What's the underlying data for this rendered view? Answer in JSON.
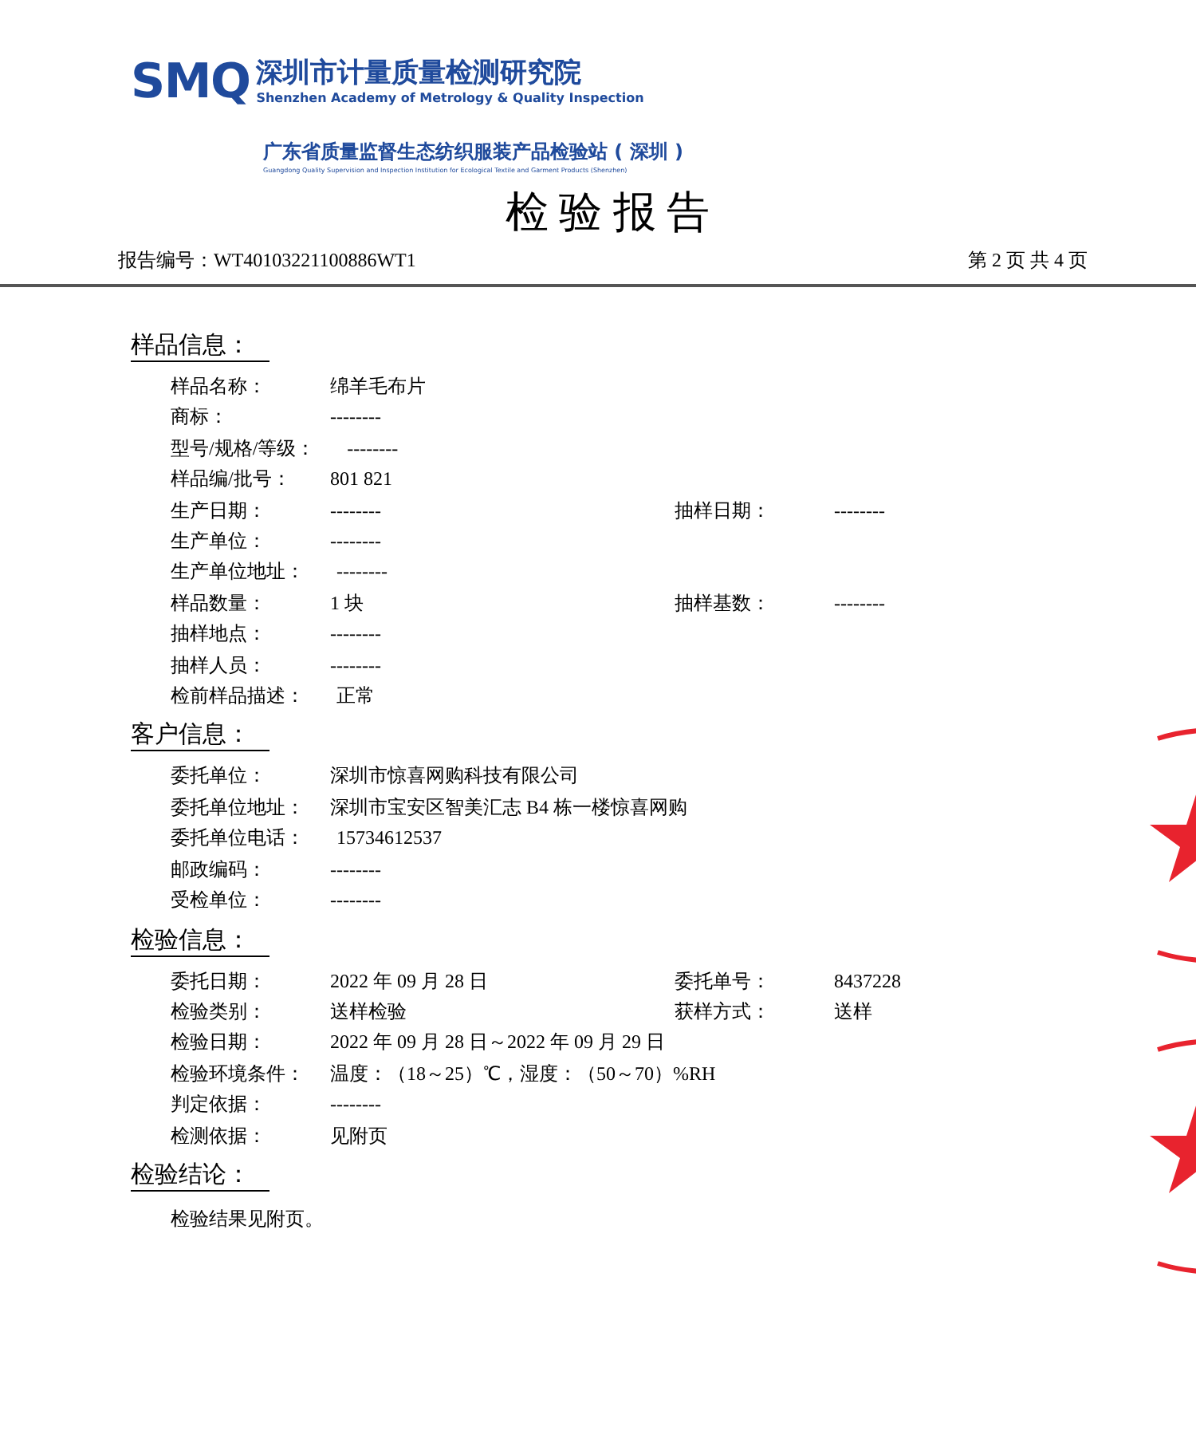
{
  "header": {
    "logo_mark": "SMQ",
    "org_name": "深圳市计量质量检测研究院",
    "org_name_en": "Shenzhen Academy of Metrology & Quality Inspection",
    "station_name": "广东省质量监督生态纺织服装产品检验站 ( 深圳 )",
    "station_name_en": "Guangdong Quality Supervision and Inspection Institution for Ecological Textile and Garment Products (Shenzhen)"
  },
  "title": "检 验 报 告",
  "report_no_label": "报告编号：",
  "report_no": "WT40103221100886WT1",
  "page_info": "第 2 页 共 4 页",
  "sections": [
    {
      "title": "样品信息：",
      "kind": "fields",
      "rows": [
        [
          {
            "label": "样品名称：",
            "value": "绵羊毛布片"
          }
        ],
        [
          {
            "label": "商标：",
            "value": "--------"
          }
        ],
        [
          {
            "label": "型号/规格/等级：",
            "value": "--------"
          }
        ],
        [
          {
            "label": "样品编/批号：",
            "value": "801 821"
          }
        ],
        [
          {
            "label": "生产日期：",
            "value": "--------"
          },
          {
            "label": "抽样日期：",
            "value": "--------"
          }
        ],
        [
          {
            "label": "生产单位：",
            "value": "--------"
          }
        ],
        [
          {
            "label": "生产单位地址：",
            "value": "--------"
          }
        ],
        [
          {
            "label": "样品数量：",
            "value": "1 块"
          },
          {
            "label": "抽样基数：",
            "value": "--------"
          }
        ],
        [
          {
            "label": "抽样地点：",
            "value": "--------"
          }
        ],
        [
          {
            "label": "抽样人员：",
            "value": "--------"
          }
        ],
        [
          {
            "label": "检前样品描述：",
            "value": "正常"
          }
        ]
      ]
    },
    {
      "title": "客户信息：",
      "kind": "fields",
      "rows": [
        [
          {
            "label": "委托单位：",
            "value": "深圳市惊喜网购科技有限公司"
          }
        ],
        [
          {
            "label": "委托单位地址：",
            "value": "深圳市宝安区智美汇志 B4 栋一楼惊喜网购"
          }
        ],
        [
          {
            "label": "委托单位电话：",
            "value": "15734612537"
          }
        ],
        [
          {
            "label": "邮政编码：",
            "value": "--------"
          }
        ],
        [
          {
            "label": "受检单位：",
            "value": "--------"
          }
        ]
      ]
    },
    {
      "title": "检验信息：",
      "kind": "fields",
      "rows": [
        [
          {
            "label": "委托日期：",
            "value": "2022 年 09 月 28 日"
          },
          {
            "label": "委托单号：",
            "value": "8437228"
          }
        ],
        [
          {
            "label": "检验类别：",
            "value": "送样检验"
          },
          {
            "label": "获样方式：",
            "value": "送样"
          }
        ],
        [
          {
            "label": "检验日期：",
            "value": "2022 年 09 月 28 日～2022 年 09 月 29 日"
          }
        ],
        [
          {
            "label": "检验环境条件：",
            "value": "温度：（18～25）℃，湿度：（50～70）%RH"
          }
        ],
        [
          {
            "label": "判定依据：",
            "value": "--------"
          }
        ],
        [
          {
            "label": "检测依据：",
            "value": "见附页"
          }
        ]
      ]
    },
    {
      "title": "检验结论：",
      "kind": "text",
      "text": "检验结果见附页。"
    }
  ]
}
